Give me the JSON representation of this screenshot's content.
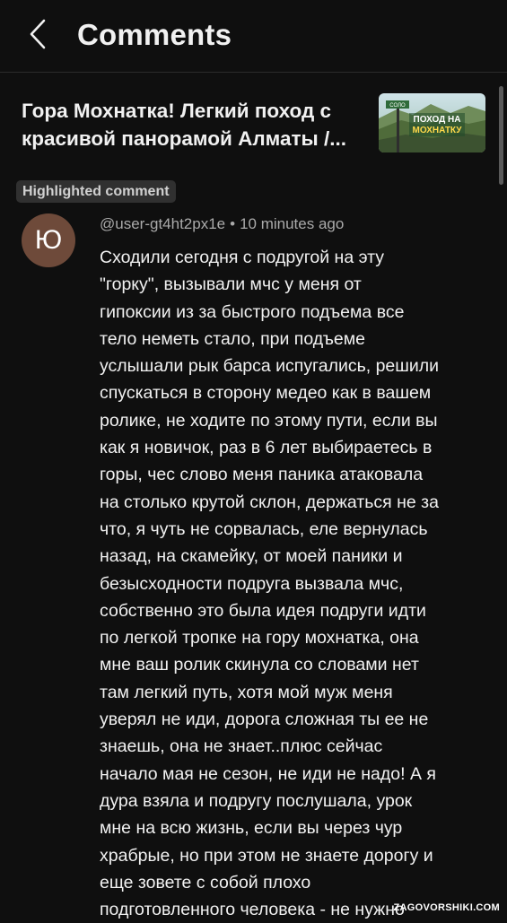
{
  "header": {
    "title": "Comments",
    "back_icon": "chevron-left-icon"
  },
  "video": {
    "title": "Гора Мохнатка! Легкий поход с красивой панорамой Алматы /...",
    "thumbnail_text_line1": "ПОХОД НА",
    "thumbnail_text_line2": "МОХНАТКУ",
    "thumbnail_sign": "СОЛО"
  },
  "highlight_label": "Highlighted comment",
  "comment": {
    "avatar_letter": "Ю",
    "avatar_color": "#6e4a3a",
    "author": "@user-gt4ht2px1e",
    "time": "10 minutes ago",
    "text": "Сходили сегодня с подругой на эту\n\"горку\", вызывали мчс у меня от\nгипоксии из за быстрого подъема все\nтело неметь стало, при подъеме\nуслышали рык барса испугались, решили\nспускаться в сторону медео как в вашем\nролике, не ходите по этому пути, если вы\nкак я новичок, раз в 6 лет  выбираетесь в\nгоры, чес слово меня паника атаковала\nна столько крутой склон, держаться не за\nчто, я чуть не сорвалась, еле вернулась\nназад, на скамейку, от моей паники и\nбезысходности подруга вызвала мчс,\nсобственно это была идея  подруги идти\nпо легкой тропке на гору мохнатка, она\nмне ваш ролик скинула со словами нет\nтам легкий путь, хотя мой муж меня\nуверял не иди, дорога сложная ты ее не\nзнаешь, она не знает..плюс сейчас\nначало мая не сезон, не иди не надо! А я\nдура взяла и подругу послушала, урок\nмне на всю жизнь, если вы через чур\nхрабрые, но при этом не знаете дорогу и\nеще зовете с собой плохо\nподготовленного человека - не нужно"
  },
  "watermark": "ZAGOVORSHIKI.COM"
}
